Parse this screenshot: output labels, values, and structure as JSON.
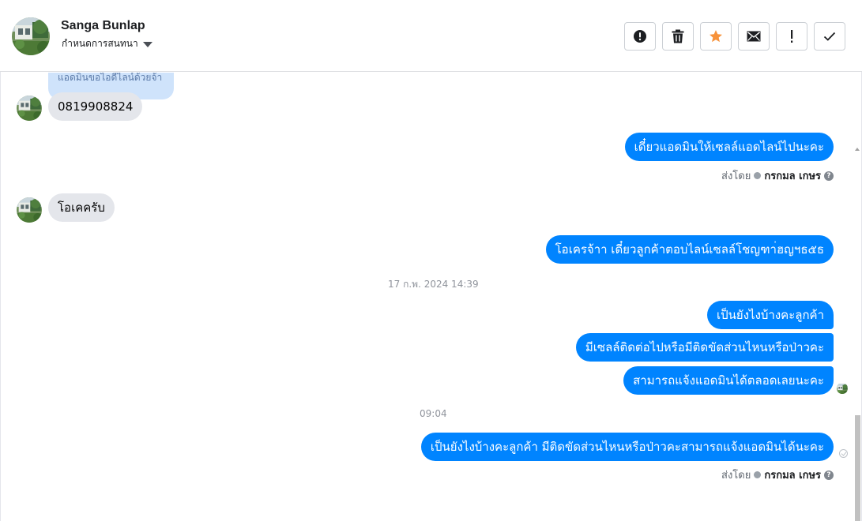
{
  "header": {
    "contact_name": "Sanga Bunlap",
    "conversation_setting": "กำหนดการสนทนา",
    "actions": [
      {
        "name": "report-button",
        "icon": "alert-circle-icon"
      },
      {
        "name": "delete-button",
        "icon": "trash-icon"
      },
      {
        "name": "star-button",
        "icon": "star-icon"
      },
      {
        "name": "mark-unread-button",
        "icon": "envelope-icon"
      },
      {
        "name": "important-button",
        "icon": "exclamation-icon"
      },
      {
        "name": "mark-done-button",
        "icon": "check-icon"
      }
    ]
  },
  "colors": {
    "outgoing_bubble": "#0084ff",
    "incoming_bubble": "#e4e6eb",
    "star": "#f7923a"
  },
  "messages": {
    "quoted": "แอดมินขอไอดีไลน์ด้วยจ้า",
    "m1": "0819908824",
    "m2": "เดี๋ยวแอดมินให้เซลล์แอดไลน์ไปนะคะ",
    "m3": "โอเคครับ",
    "m4": "โอเครจ้าา เดี๋ยวลูกค้าตอบไลน์เซลล์โชญฑา่ฮญฯธ๕ธ",
    "ts1": "17 ก.พ. 2024 14:39",
    "m5": "เป็นยังไงบ้างคะลูกค้า",
    "m6": "มีเซลล์ติดต่อไปหรือมีติดขัดส่วนไหนหรือป่าวคะ",
    "m7": "สามารถแจ้งแอดมินได้ตลอดเลยนะคะ",
    "ts2": "09:04",
    "m8": "เป็นยังไงบ้างคะลูกค้า มีติดขัดส่วนไหนหรือป่าวคะสามารถแจ้งแอดมินได้นะคะ"
  },
  "sent_by": {
    "label": "ส่งโดย",
    "name": "กรกมล เกษร",
    "help": "?"
  }
}
